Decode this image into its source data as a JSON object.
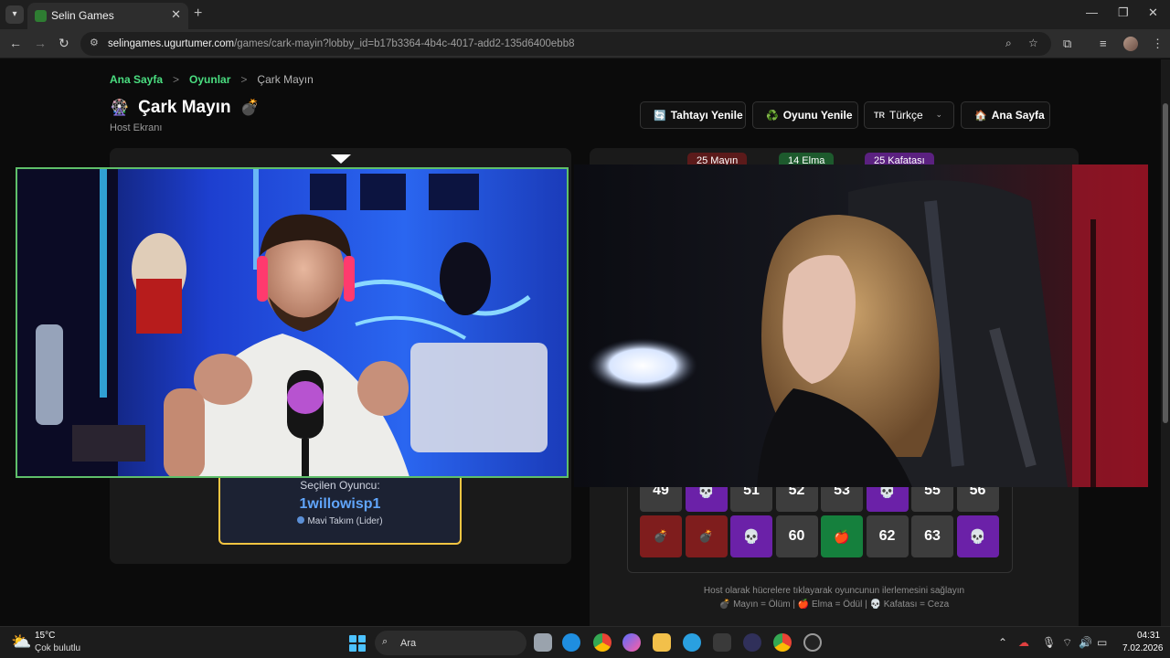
{
  "browser": {
    "tab_title": "Selin Games",
    "tab_close": "✕",
    "new_tab": "+",
    "url_host": "selingames.ugurtumer.com",
    "url_path": "/games/cark-mayin?lobby_id=b17b3364-4b4c-4017-add2-135d6400ebb8",
    "minimize": "—",
    "restore": "❐",
    "close": "✕"
  },
  "breadcrumb": {
    "home": "Ana Sayfa",
    "games": "Oyunlar",
    "current": "Çark Mayın",
    "separator": ">"
  },
  "header": {
    "title": "Çark Mayın",
    "subtitle": "Host Ekranı",
    "title_icon_left": "🎡",
    "title_icon_right": "💣"
  },
  "buttons": {
    "refresh_board": "Tahtayı Yenile",
    "refresh_game": "Oyunu Yenile",
    "language_code": "TR",
    "language": "Türkçe",
    "home": "Ana Sayfa"
  },
  "selected_player": {
    "label": "Seçilen Oyuncu:",
    "name": "1willowisp1",
    "team": "Mavi Takım (Lider)"
  },
  "stats": {
    "mines": "25 Mayın",
    "apples": "14 Elma",
    "skulls": "25 Kafatası"
  },
  "board": {
    "row1": [
      {
        "label": "49",
        "type": "number"
      },
      {
        "label": "💀",
        "type": "skull"
      },
      {
        "label": "51",
        "type": "number"
      },
      {
        "label": "52",
        "type": "number"
      },
      {
        "label": "53",
        "type": "number"
      },
      {
        "label": "💀",
        "type": "skull"
      },
      {
        "label": "55",
        "type": "number"
      },
      {
        "label": "56",
        "type": "number"
      }
    ],
    "row2": [
      {
        "label": "💣",
        "type": "mine"
      },
      {
        "label": "💣",
        "type": "mine"
      },
      {
        "label": "💀",
        "type": "skull"
      },
      {
        "label": "60",
        "type": "number"
      },
      {
        "label": "🍎",
        "type": "apple"
      },
      {
        "label": "62",
        "type": "number"
      },
      {
        "label": "63",
        "type": "number"
      },
      {
        "label": "💀",
        "type": "skull"
      }
    ]
  },
  "info": {
    "line1": "Host olarak hücrelere tıklayarak oyuncunun ilerlemesini sağlayın",
    "line2": "💣 Mayın = Ölüm | 🍎 Elma = Ödül | 💀 Kafatası = Ceza"
  },
  "taskbar": {
    "temperature": "15°C",
    "weather": "Çok bulutlu",
    "search": "Ara",
    "time": "04:31",
    "date": "7.02.2026"
  },
  "colors": {
    "accent_green": "#4ade80",
    "player_blue": "#60a5fa",
    "selected_border": "#f5c542",
    "skull_purple": "#6b21a8",
    "mine_red": "#7f1d1d",
    "apple_green": "#15803d"
  }
}
